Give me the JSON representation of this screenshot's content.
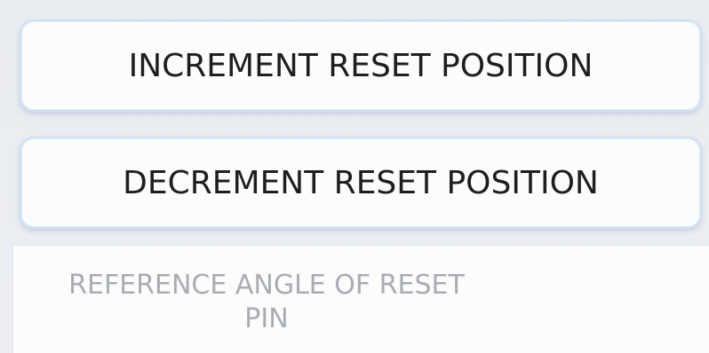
{
  "buttons": {
    "increment_label": "INCREMENT RESET POSITION",
    "decrement_label": "DECREMENT RESET POSITION"
  },
  "reference_field": {
    "label": "REFERENCE ANGLE OF RESET\nPIN"
  }
}
